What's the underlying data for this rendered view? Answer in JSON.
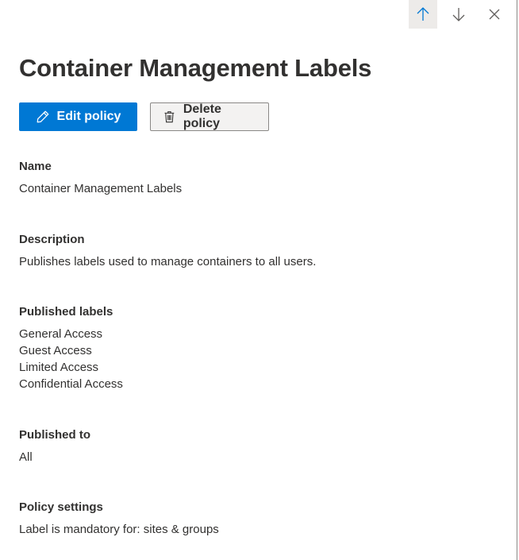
{
  "header": {
    "title": "Container Management Labels",
    "nav": {
      "previous_icon": "arrow-up-icon",
      "next_icon": "arrow-down-icon",
      "close_icon": "close-icon"
    }
  },
  "actions": {
    "edit": {
      "label": "Edit policy",
      "icon": "pencil-icon"
    },
    "delete": {
      "label": "Delete policy",
      "icon": "trash-icon"
    }
  },
  "details": {
    "name": {
      "label": "Name",
      "value": "Container Management Labels"
    },
    "description": {
      "label": "Description",
      "value": "Publishes labels used to manage containers to all users."
    },
    "published_labels": {
      "label": "Published labels",
      "items": [
        "General Access",
        "Guest Access",
        "Limited Access",
        "Confidential Access"
      ]
    },
    "published_to": {
      "label": "Published to",
      "value": "All"
    },
    "policy_settings": {
      "label": "Policy settings",
      "value": "Label is mandatory for: sites & groups"
    }
  },
  "colors": {
    "primary": "#0078d4",
    "text": "#323130",
    "secondary_bg": "#f3f2f1"
  }
}
